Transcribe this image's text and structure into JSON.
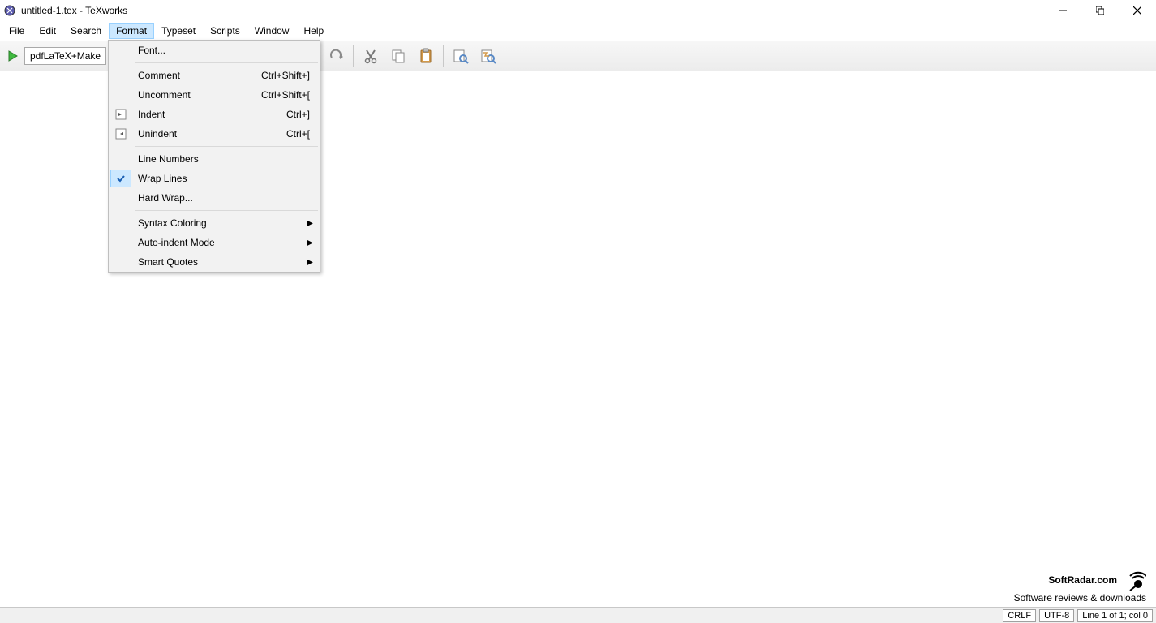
{
  "window": {
    "title": "untitled-1.tex - TeXworks"
  },
  "menubar": {
    "file": "File",
    "edit": "Edit",
    "search": "Search",
    "format": "Format",
    "typeset": "Typeset",
    "scripts": "Scripts",
    "window": "Window",
    "help": "Help"
  },
  "toolbar": {
    "combo": "pdfLaTeX+Make"
  },
  "format_menu": {
    "font": "Font...",
    "comment": {
      "label": "Comment",
      "shortcut": "Ctrl+Shift+]"
    },
    "uncomment": {
      "label": "Uncomment",
      "shortcut": "Ctrl+Shift+["
    },
    "indent": {
      "label": "Indent",
      "shortcut": "Ctrl+]"
    },
    "unindent": {
      "label": "Unindent",
      "shortcut": "Ctrl+["
    },
    "line_numbers": "Line Numbers",
    "wrap_lines": "Wrap Lines",
    "hard_wrap": "Hard Wrap...",
    "syntax_coloring": "Syntax Coloring",
    "auto_indent": "Auto-indent Mode",
    "smart_quotes": "Smart Quotes"
  },
  "statusbar": {
    "eol": "CRLF",
    "encoding": "UTF-8",
    "position": "Line 1 of 1; col 0"
  },
  "watermark": {
    "line1": "SoftRadar.com",
    "line2": "Software reviews & downloads"
  }
}
